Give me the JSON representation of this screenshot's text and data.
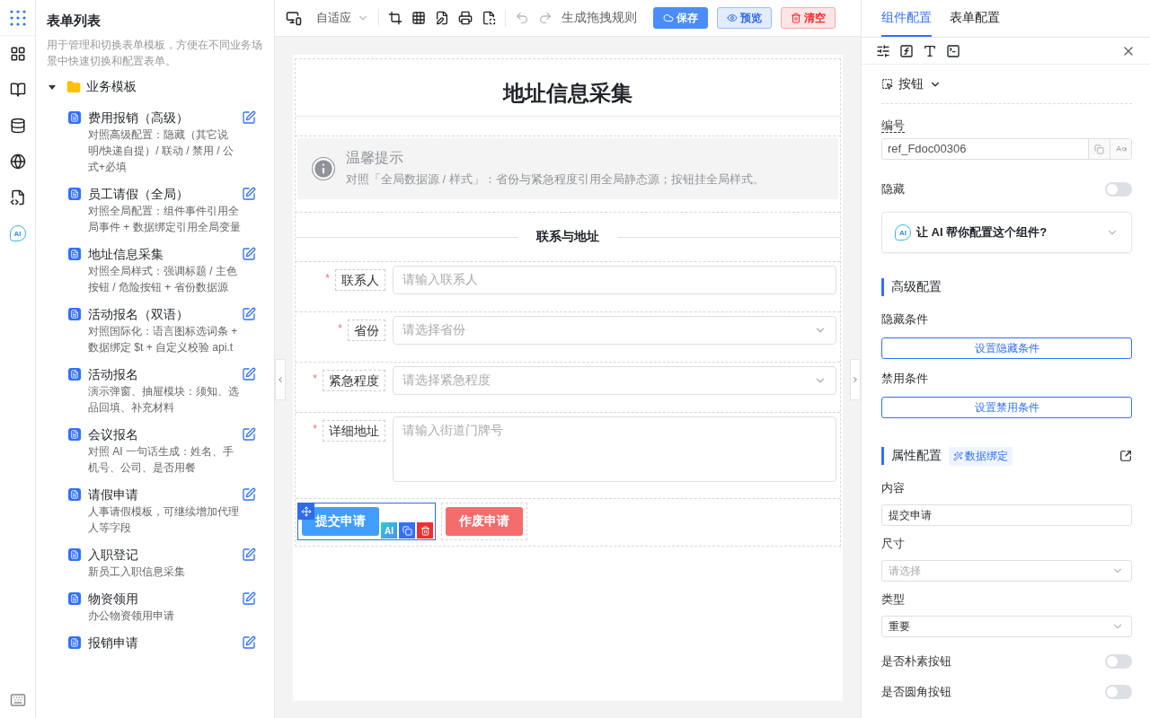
{
  "rail": {
    "ai_label": "AI"
  },
  "sidebar": {
    "title": "表单列表",
    "description": "用于管理和切换表单模板，方便在不同业务场景中快速切换和配置表单。",
    "folder": {
      "label": "业务模板",
      "expanded": true,
      "children": [
        {
          "title": "费用报销（高级）",
          "description": "对照高级配置：隐藏（其它说明/快递自提）/ 联动 / 禁用 / 公式+必填"
        },
        {
          "title": "员工请假（全局）",
          "description": "对照全局配置：组件事件引用全局事件 + 数据绑定引用全局变量"
        },
        {
          "title": "地址信息采集",
          "description": "对照全局样式：强调标题 / 主色按钮 / 危险按钮 + 省份数据源"
        },
        {
          "title": "活动报名（双语）",
          "description": "对照国际化：语言图标选词条 + 数据绑定 $t + 自定义校验 api.t"
        },
        {
          "title": "活动报名",
          "description": "演示弹窗、抽屉模块：须知、选品回填、补充材料"
        },
        {
          "title": "会议报名",
          "description": "对照 AI 一句话生成：姓名、手机号、公司、是否用餐"
        },
        {
          "title": "请假申请",
          "description": "人事请假模板，可继续增加代理人等字段"
        },
        {
          "title": "入职登记",
          "description": "新员工入职信息采集"
        },
        {
          "title": "物资领用",
          "description": "办公物资领用申请"
        },
        {
          "title": "报销申请"
        }
      ]
    }
  },
  "toolbar": {
    "device": "自适应",
    "rule_link": "生成拖拽规则",
    "buttons": [
      {
        "label": "保存",
        "kind": "primary"
      },
      {
        "label": "预览",
        "kind": "preview"
      },
      {
        "label": "清空",
        "kind": "danger"
      }
    ]
  },
  "form": {
    "title": "地址信息采集",
    "alert": {
      "title": "温馨提示",
      "text": "对照「全局数据源 / 样式」：省份与紧急程度引用全局静态源；按钮挂全局样式。"
    },
    "divider": "联系与地址",
    "fields": [
      {
        "label": "联系人",
        "required_mark": "*",
        "kind": "input",
        "placeholder": "请输入联系人"
      },
      {
        "label": "省份",
        "required_mark": "*",
        "kind": "select",
        "placeholder": "请选择省份"
      },
      {
        "label": "紧急程度",
        "required_mark": "*",
        "kind": "select",
        "placeholder": "请选择紧急程度"
      },
      {
        "label": "详细地址",
        "required_mark": "*",
        "kind": "textarea",
        "placeholder": "请输入街道门牌号"
      }
    ],
    "buttons": [
      {
        "label": "提交申请",
        "kind": "primary",
        "selected": true
      },
      {
        "label": "作废申请",
        "kind": "danger",
        "selected": false
      }
    ],
    "ai_badge": "AI"
  },
  "panel": {
    "tabs": [
      {
        "label": "组件配置",
        "selected": true
      },
      {
        "label": "表单配置",
        "selected": false
      }
    ],
    "component_type": "按钮",
    "id_label": "编号",
    "id_value": "ref_Fdoc00306",
    "hidden": {
      "label": "隐藏",
      "on": false
    },
    "ai_prompt": {
      "badge": "AI",
      "text": "让 AI 帮你配置这个组件?"
    },
    "advanced": {
      "title": "高级配置",
      "rows": [
        {
          "label": "隐藏条件",
          "button": "设置隐藏条件"
        },
        {
          "label": "禁用条件",
          "button": "设置禁用条件"
        }
      ]
    },
    "props": {
      "title": "属性配置",
      "binding": "数据绑定",
      "fields": [
        {
          "label": "内容",
          "kind": "input",
          "value": "提交申请"
        },
        {
          "label": "尺寸",
          "kind": "select",
          "placeholder": "请选择"
        },
        {
          "label": "类型",
          "kind": "select",
          "value": "重要"
        }
      ],
      "toggles": [
        {
          "label": "是否朴素按钮",
          "on": false
        },
        {
          "label": "是否圆角按钮",
          "on": false
        }
      ]
    }
  }
}
